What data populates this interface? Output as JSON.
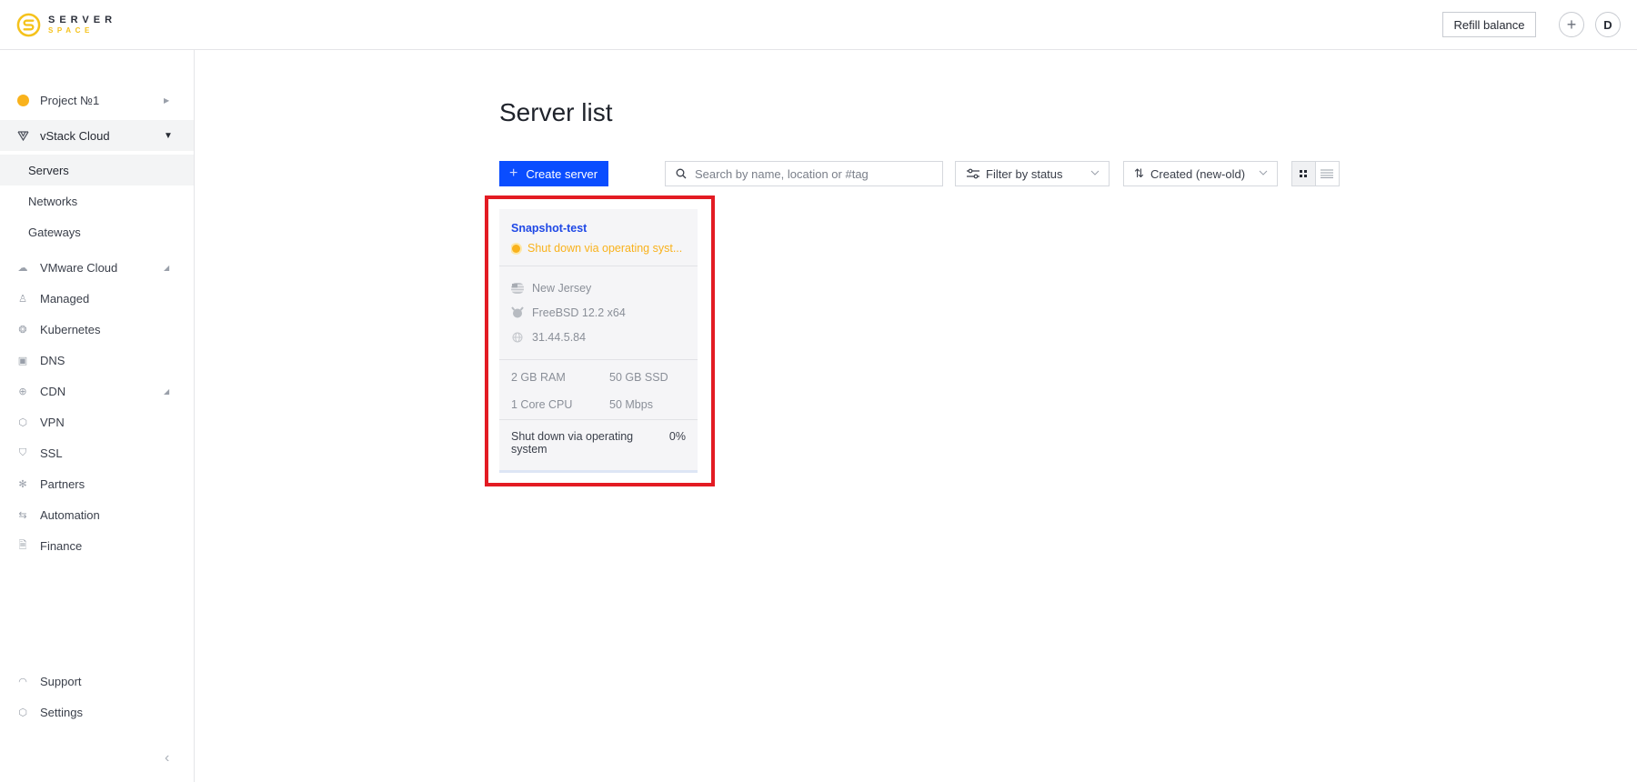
{
  "header": {
    "logo_top": "SERVER",
    "logo_bottom": "SPACE",
    "refill_label": "Refill balance",
    "add_icon": "plus-icon",
    "avatar_initial": "D"
  },
  "sidebar": {
    "project": {
      "label": "Project №1",
      "icon": "project-dot-icon"
    },
    "groups": [
      {
        "label": "vStack Cloud",
        "icon": "vstack-icon",
        "expanded": true,
        "children": [
          {
            "label": "Servers",
            "active": true
          },
          {
            "label": "Networks"
          },
          {
            "label": "Gateways"
          }
        ]
      }
    ],
    "items": [
      {
        "label": "VMware Cloud",
        "icon": "cloud-icon",
        "has_arrow": true
      },
      {
        "label": "Managed",
        "icon": "managed-icon"
      },
      {
        "label": "Kubernetes",
        "icon": "kubernetes-icon"
      },
      {
        "label": "DNS",
        "icon": "dns-icon"
      },
      {
        "label": "CDN",
        "icon": "globe-icon",
        "has_arrow": true
      },
      {
        "label": "VPN",
        "icon": "vpn-shield-icon"
      },
      {
        "label": "SSL",
        "icon": "shield-icon"
      },
      {
        "label": "Partners",
        "icon": "partners-icon"
      },
      {
        "label": "Automation",
        "icon": "automation-icon"
      },
      {
        "label": "Finance",
        "icon": "document-icon"
      }
    ],
    "bottom": [
      {
        "label": "Support",
        "icon": "headset-icon"
      },
      {
        "label": "Settings",
        "icon": "gear-icon"
      }
    ],
    "collapse_icon": "chevron-left-icon"
  },
  "main": {
    "title": "Server list",
    "create_label": "Create server",
    "search": {
      "placeholder": "Search by name, location or #tag",
      "value": ""
    },
    "filter": {
      "value": "Filter by status"
    },
    "sort": {
      "value": "Created (new-old)"
    },
    "view_mode": "grid",
    "servers": [
      {
        "name": "Snapshot-test",
        "status": "Shut down via operating syst...",
        "status_color": "#f9b21c",
        "location": "New Jersey",
        "os": "FreeBSD 12.2 x64",
        "ip": "31.44.5.84",
        "ram": "2 GB RAM",
        "disk": "50 GB SSD",
        "cpu": "1 Core CPU",
        "bandwidth": "50 Mbps",
        "task": "Shut down via operating system",
        "progress_label": "0%",
        "progress": 0
      }
    ]
  },
  "colors": {
    "accent": "#0a4dff",
    "warning": "#f9b21c",
    "highlight": "#e31b23",
    "link": "#1f48e6"
  }
}
